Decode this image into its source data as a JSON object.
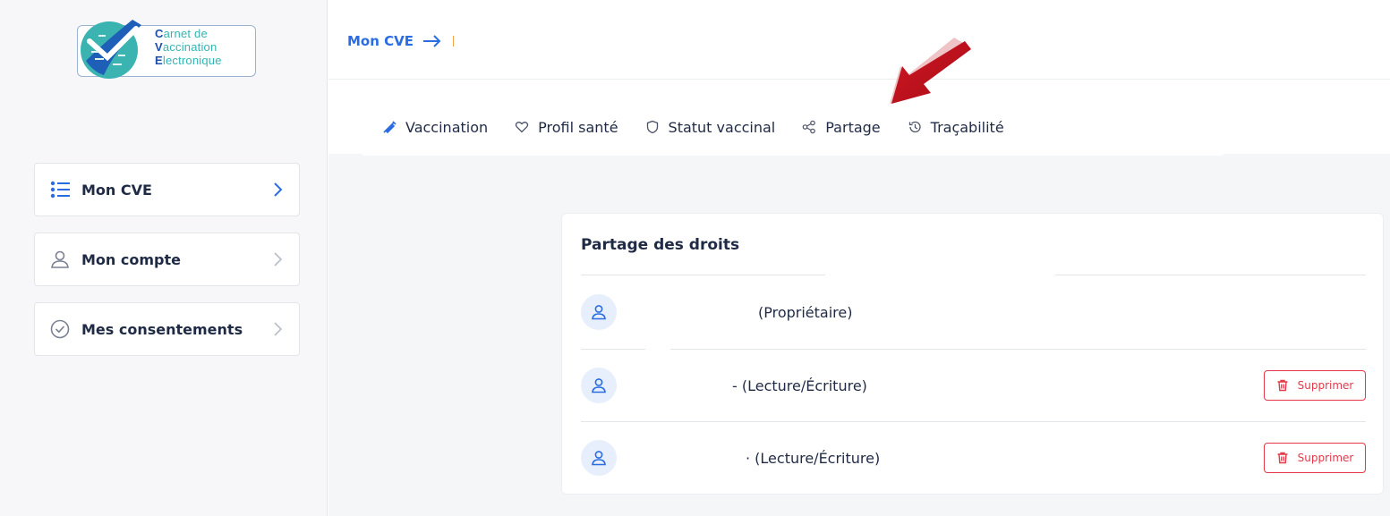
{
  "logo": {
    "line1_initial": "C",
    "line1_rest": "arnet de",
    "line2_initial": "V",
    "line2_rest": "accination",
    "line3_initial": "E",
    "line3_rest": "lectronique"
  },
  "sidebar": {
    "items": [
      {
        "label": "Mon CVE",
        "icon": "list-icon",
        "active": true
      },
      {
        "label": "Mon compte",
        "icon": "user-icon",
        "active": false
      },
      {
        "label": "Mes consentements",
        "icon": "check-circle-icon",
        "active": false
      }
    ]
  },
  "header": {
    "breadcrumb": "Mon CVE"
  },
  "tabs": [
    {
      "label": "Vaccination",
      "icon": "syringe-icon"
    },
    {
      "label": "Profil santé",
      "icon": "heart-icon"
    },
    {
      "label": "Statut vaccinal",
      "icon": "shield-icon"
    },
    {
      "label": "Partage",
      "icon": "share-icon"
    },
    {
      "label": "Traçabilité",
      "icon": "history-icon"
    }
  ],
  "card": {
    "title": "Partage des droits",
    "rows": [
      {
        "text": "(Propriétaire)",
        "deletable": false
      },
      {
        "text": "- (Lecture/Écriture)",
        "deletable": true
      },
      {
        "text": "· (Lecture/Écriture)",
        "deletable": true
      }
    ],
    "delete_label": "Supprimer"
  },
  "colors": {
    "accent": "#2b6de1",
    "danger": "#e4394a",
    "annotation": "#c0111c",
    "logo_teal": "#33b5b2",
    "logo_blue": "#1e4fa8"
  }
}
